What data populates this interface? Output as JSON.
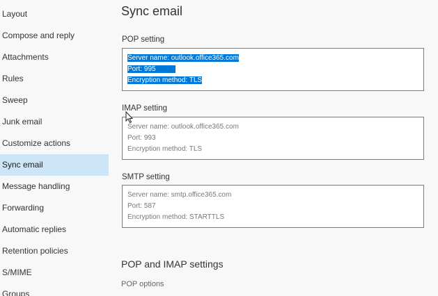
{
  "sidebar": {
    "items": [
      {
        "label": "Layout"
      },
      {
        "label": "Compose and reply"
      },
      {
        "label": "Attachments"
      },
      {
        "label": "Rules"
      },
      {
        "label": "Sweep"
      },
      {
        "label": "Junk email"
      },
      {
        "label": "Customize actions"
      },
      {
        "label": "Sync email",
        "selected": true
      },
      {
        "label": "Message handling"
      },
      {
        "label": "Forwarding"
      },
      {
        "label": "Automatic replies"
      },
      {
        "label": "Retention policies"
      },
      {
        "label": "S/MIME"
      },
      {
        "label": "Groups"
      }
    ]
  },
  "main": {
    "title": "Sync email",
    "pop": {
      "label": "POP setting",
      "server": "Server name: outlook.office365.com",
      "port": "Port: 995",
      "encryption": "Encryption method: TLS"
    },
    "imap": {
      "label": "IMAP setting",
      "server": "Server name: outlook.office365.com",
      "port": "Port: 993",
      "encryption": "Encryption method: TLS"
    },
    "smtp": {
      "label": "SMTP setting",
      "server": "Server name: smtp.office365.com",
      "port": "Port: 587",
      "encryption": "Encryption method: STARTTLS"
    },
    "pop_imap_heading": "POP and IMAP settings",
    "pop_options": "POP options"
  },
  "colors": {
    "selected_nav_bg": "#cde6f7",
    "text_selection": "#0078d7"
  },
  "icons": {
    "cursor": "mouse-pointer-icon"
  }
}
